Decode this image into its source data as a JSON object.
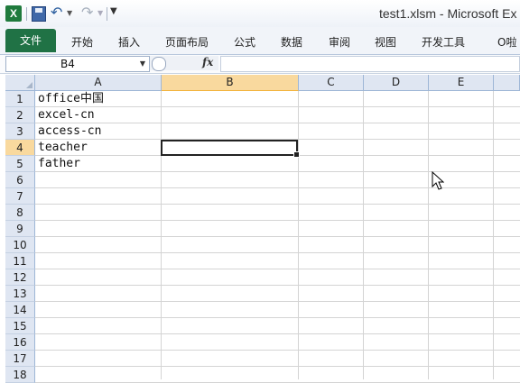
{
  "window": {
    "title": "test1.xlsm  -  Microsoft Ex",
    "app_icon_label": "X"
  },
  "quick_access": {
    "save_icon": "save-icon",
    "undo_icon": "undo-icon",
    "redo_icon": "redo-icon",
    "customize_icon": "customize-icon"
  },
  "ribbon": {
    "file_tab": "文件",
    "tabs": [
      "开始",
      "插入",
      "页面布局",
      "公式",
      "数据",
      "审阅",
      "视图",
      "开发工具",
      "O啦"
    ]
  },
  "formula_bar": {
    "name_box": "B4",
    "fx_label": "fx",
    "formula": ""
  },
  "grid": {
    "columns": [
      "A",
      "B",
      "C",
      "D",
      "E"
    ],
    "rows": [
      "1",
      "2",
      "3",
      "4",
      "5",
      "6",
      "7",
      "8",
      "9",
      "10",
      "11",
      "12",
      "13",
      "14",
      "15",
      "16",
      "17",
      "18"
    ],
    "active_cell": "B4",
    "column_a_values": [
      "office中国",
      "excel-cn",
      "access-cn",
      "teacher",
      "father"
    ]
  },
  "colors": {
    "file_tab": "#207245",
    "header_bg": "#dfe6f2",
    "active_header": "#f9d99e"
  }
}
